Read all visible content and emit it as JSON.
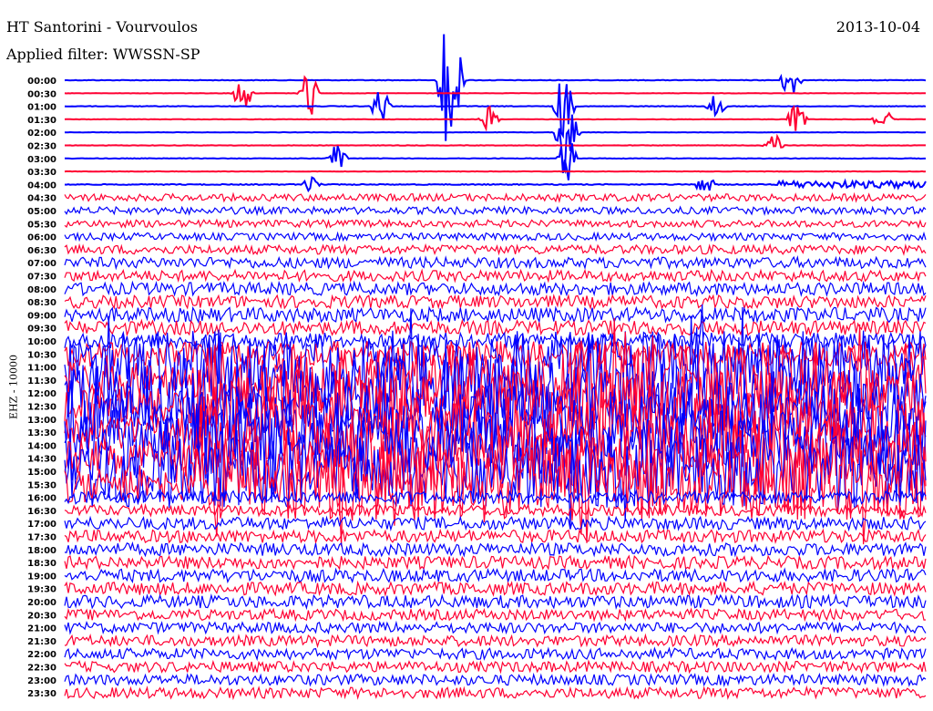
{
  "header": {
    "title": "HT Santorini - Vourvoulos",
    "filter": "Applied filter: WWSSN-SP",
    "date": "2013-10-04"
  },
  "chart_data": {
    "type": "line",
    "title": "HT Santorini - Vourvoulos",
    "subtitle": "Applied filter: WWSSN-SP",
    "ylabel": "EHZ - 10000",
    "xlabel": "",
    "row_minutes": 30,
    "colors": [
      "#0000ff",
      "#ff0033"
    ],
    "rows": [
      "00:00",
      "00:30",
      "01:00",
      "01:30",
      "02:00",
      "02:30",
      "03:00",
      "03:30",
      "04:00",
      "04:30",
      "05:00",
      "05:30",
      "06:00",
      "06:30",
      "07:00",
      "07:30",
      "08:00",
      "08:30",
      "09:00",
      "09:30",
      "10:00",
      "10:30",
      "11:00",
      "11:30",
      "12:00",
      "12:30",
      "13:00",
      "13:30",
      "14:00",
      "14:30",
      "15:00",
      "15:30",
      "16:00",
      "16:30",
      "17:00",
      "17:30",
      "18:00",
      "18:30",
      "19:00",
      "19:30",
      "20:00",
      "20:30",
      "21:00",
      "21:30",
      "22:00",
      "22:30",
      "23:00",
      "23:30"
    ],
    "noise_level": [
      0.3,
      0.2,
      0.3,
      0.2,
      0.2,
      0.2,
      0.3,
      0.2,
      0.5,
      4,
      4,
      4,
      4,
      5,
      6,
      6,
      7,
      7,
      8,
      8,
      9,
      14,
      40,
      40,
      40,
      40,
      40,
      40,
      40,
      40,
      40,
      40,
      7,
      6,
      7,
      7,
      7,
      7,
      7,
      7,
      7,
      6,
      6,
      6,
      6,
      6,
      6,
      6
    ],
    "events": [
      {
        "row": 0,
        "minute": 13.3,
        "amp": 70
      },
      {
        "row": 0,
        "minute": 13.6,
        "amp": 50
      },
      {
        "row": 0,
        "minute": 25.3,
        "amp": 30
      },
      {
        "row": 1,
        "minute": 8.5,
        "amp": 35
      },
      {
        "row": 1,
        "minute": 6.2,
        "amp": 25
      },
      {
        "row": 2,
        "minute": 11.0,
        "amp": 25
      },
      {
        "row": 2,
        "minute": 17.4,
        "amp": 45
      },
      {
        "row": 2,
        "minute": 22.7,
        "amp": 20
      },
      {
        "row": 3,
        "minute": 14.8,
        "amp": 15
      },
      {
        "row": 3,
        "minute": 25.5,
        "amp": 20
      },
      {
        "row": 3,
        "minute": 28.5,
        "amp": 18
      },
      {
        "row": 4,
        "minute": 17.4,
        "amp": 40
      },
      {
        "row": 4,
        "minute": 17.6,
        "amp": 30
      },
      {
        "row": 5,
        "minute": 24.7,
        "amp": 18
      },
      {
        "row": 6,
        "minute": 9.5,
        "amp": 20
      },
      {
        "row": 6,
        "minute": 17.5,
        "amp": 30
      },
      {
        "row": 8,
        "minute": 22.3,
        "amp": 15
      },
      {
        "row": 8,
        "minute": 8.6,
        "amp": 10
      }
    ]
  }
}
